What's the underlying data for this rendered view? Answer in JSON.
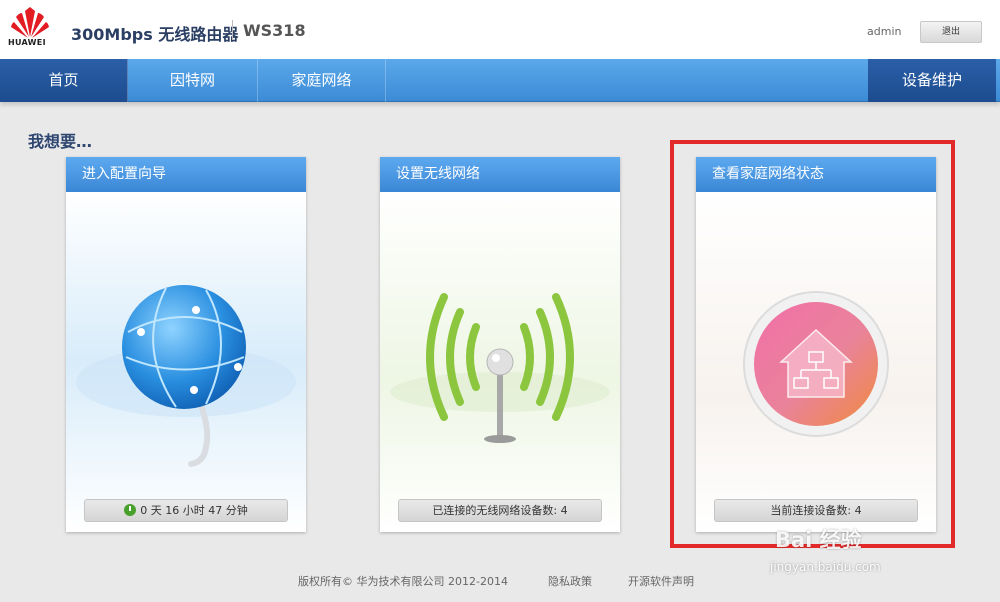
{
  "header": {
    "brand": "HUAWEI",
    "product": "300Mbps 无线路由器",
    "model": "WS318",
    "user": "admin",
    "logout_label": "退出"
  },
  "nav": {
    "items": [
      {
        "label": "首页",
        "active": true
      },
      {
        "label": "因特网"
      },
      {
        "label": "家庭网络"
      }
    ],
    "right_item": {
      "label": "设备维护"
    }
  },
  "main": {
    "section_title": "我想要…",
    "cards": [
      {
        "title": "进入配置向导",
        "footer": "0 天 16 小时 47 分钟",
        "footer_icon": "clock-icon"
      },
      {
        "title": "设置无线网络",
        "footer": "已连接的无线网络设备数: 4",
        "icon": "wifi-antenna-icon"
      },
      {
        "title": "查看家庭网络状态",
        "footer": "当前连接设备数: 4",
        "icon": "home-network-icon"
      }
    ]
  },
  "footer": {
    "copyright": "版权所有© 华为技术有限公司 2012-2014",
    "privacy": "隐私政策",
    "opensource": "开源软件声明"
  },
  "watermark": {
    "text": "Bai 经验",
    "url": "jingyan.baidu.com"
  },
  "colors": {
    "nav_blue": "#3c8bd6",
    "nav_active": "#1d4c8f",
    "highlight_red": "#e32a2a"
  }
}
